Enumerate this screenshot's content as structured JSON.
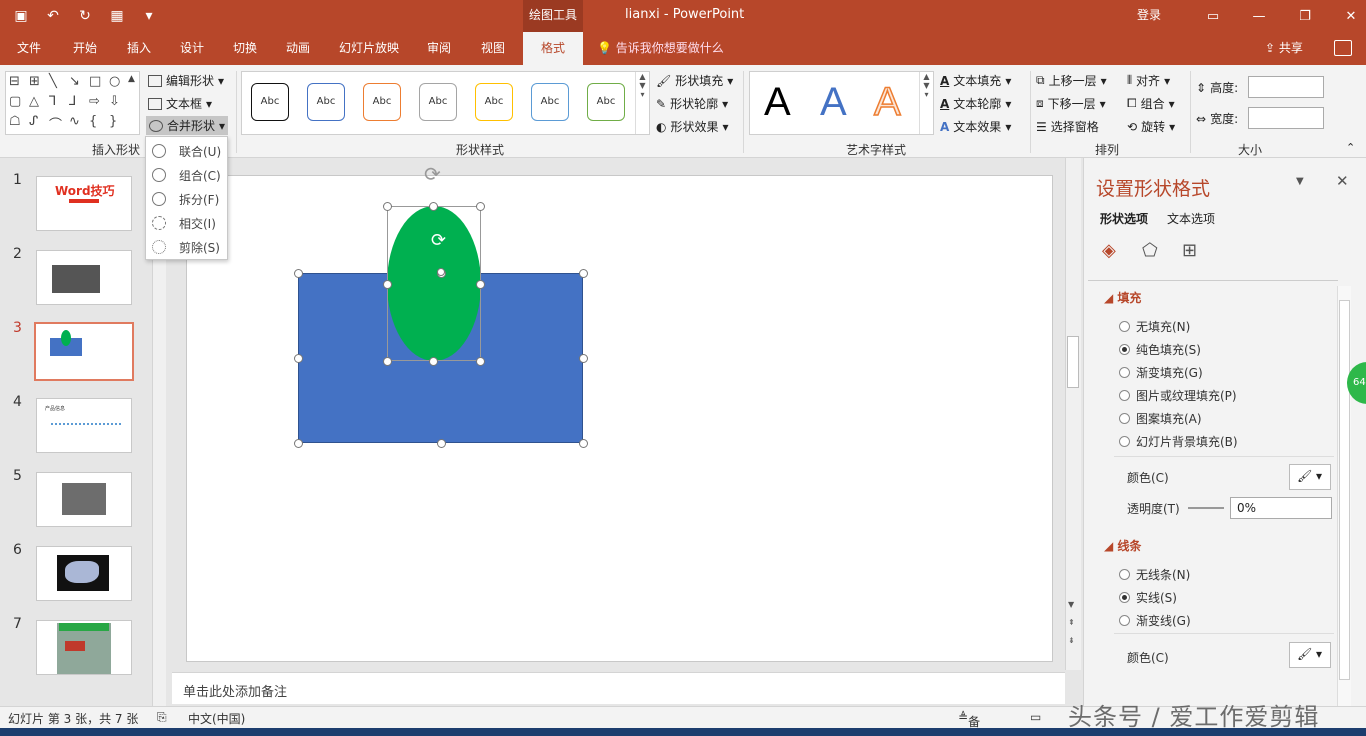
{
  "window": {
    "contextual_tab": "绘图工具",
    "title": "lianxi - PowerPoint",
    "login": "登录"
  },
  "tabs": [
    "文件",
    "开始",
    "插入",
    "设计",
    "切换",
    "动画",
    "幻灯片放映",
    "审阅",
    "视图",
    "格式"
  ],
  "tell_me": "告诉我你想要做什么",
  "share": "共享",
  "ribbon": {
    "insert_shapes_label": "插入形状",
    "edit_shape": "编辑形状",
    "text_box": "文本框",
    "merge_shapes": "合并形状",
    "shape_styles_label": "形状样式",
    "abc_label": "Abc",
    "shape_fill": "形状填充",
    "shape_outline": "形状轮廓",
    "shape_effects": "形状效果",
    "wordart_label": "艺术字样式",
    "wordart_letter": "A",
    "text_fill": "文本填充",
    "text_outline": "文本轮廓",
    "text_effects": "文本效果",
    "arrange_label": "排列",
    "bring_forward": "上移一层",
    "send_backward": "下移一层",
    "selection_pane": "选择窗格",
    "align": "对齐",
    "group": "组合",
    "rotate": "旋转",
    "size_label": "大小",
    "height": "高度:",
    "width": "宽度:"
  },
  "merge_menu": [
    {
      "label": "联合(U)"
    },
    {
      "label": "组合(C)"
    },
    {
      "label": "拆分(F)"
    },
    {
      "label": "相交(I)"
    },
    {
      "label": "剪除(S)"
    }
  ],
  "thumbnails": [
    {
      "num": "1",
      "text": "Word技巧"
    },
    {
      "num": "2",
      "text": ""
    },
    {
      "num": "3",
      "text": ""
    },
    {
      "num": "4",
      "text": "产品信息"
    },
    {
      "num": "5",
      "text": ""
    },
    {
      "num": "6",
      "text": ""
    },
    {
      "num": "7",
      "text": ""
    }
  ],
  "notes_placeholder": "单击此处添加备注",
  "format_pane": {
    "title": "设置形状格式",
    "tab_shape": "形状选项",
    "tab_text": "文本选项",
    "fill_section": "填充",
    "fill_options": [
      "无填充(N)",
      "纯色填充(S)",
      "渐变填充(G)",
      "图片或纹理填充(P)",
      "图案填充(A)",
      "幻灯片背景填充(B)"
    ],
    "fill_selected": "纯色填充(S)",
    "color_label": "颜色(C)",
    "transparency_label": "透明度(T)",
    "transparency_value": "0%",
    "line_section": "线条",
    "line_options": [
      "无线条(N)",
      "实线(S)",
      "渐变线(G)"
    ],
    "line_selected": "实线(S)",
    "line_color_label": "颜色(C)"
  },
  "status": {
    "slide_info": "幻灯片 第 3 张，共 7 张",
    "language": "中文(中国)",
    "notes_btn": "备注"
  },
  "watermark": "头条号 / 爱工作爱剪辑",
  "zoom_badge": "64",
  "colors": {
    "accent": "#b7472a",
    "rect_fill": "#4472c4",
    "ellipse_fill": "#00b050"
  }
}
